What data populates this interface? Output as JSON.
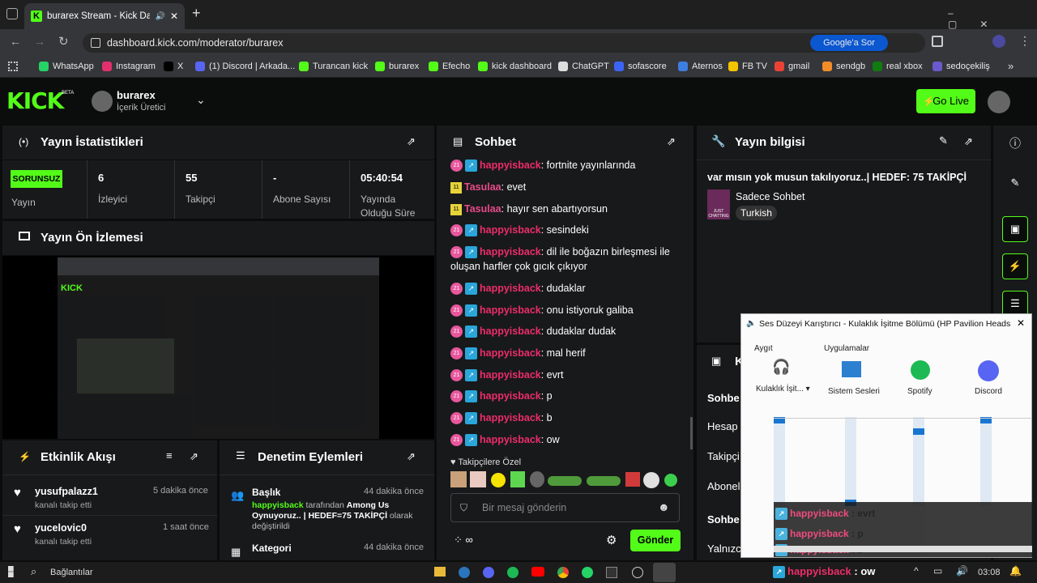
{
  "browser": {
    "tab_title": "burarex Stream - Kick Dashb",
    "url": "dashboard.kick.com/moderator/burarex",
    "google_btn": "Google'a Sor",
    "bookmarks": [
      {
        "label": "WhatsApp",
        "color": "#25d366"
      },
      {
        "label": "Instagram",
        "color": "#e1306c"
      },
      {
        "label": "X",
        "color": "#000000"
      },
      {
        "label": "(1) Discord | Arkada...",
        "color": "#5865f2"
      },
      {
        "label": "Turancan kick",
        "color": "#53fc18"
      },
      {
        "label": "burarex",
        "color": "#53fc18"
      },
      {
        "label": "Efecho",
        "color": "#53fc18"
      },
      {
        "label": "kick dashboard",
        "color": "#53fc18"
      },
      {
        "label": "ChatGPT",
        "color": "#dddddd"
      },
      {
        "label": "sofascore",
        "color": "#3c64f4"
      },
      {
        "label": "Aternos",
        "color": "#3d7ee0"
      },
      {
        "label": "FB TV",
        "color": "#f5c400"
      },
      {
        "label": "gmail",
        "color": "#ea4335"
      },
      {
        "label": "sendgb",
        "color": "#f28c28"
      },
      {
        "label": "real xbox",
        "color": "#107c10"
      },
      {
        "label": "sedoçekiliş",
        "color": "#6a5acd"
      }
    ]
  },
  "header": {
    "logo": "KICK",
    "beta": "BETA",
    "username": "burarex",
    "role": "İçerik Üretici",
    "go_live": "Go Live"
  },
  "stats": {
    "title": "Yayın İstatistikleri",
    "status_badge": "SORUNSUZ",
    "status_label": "Yayın",
    "viewers_value": "6",
    "viewers_label": "İzleyici",
    "followers_value": "55",
    "followers_label": "Takipçi",
    "subs_value": "-",
    "subs_label": "Abone Sayısı",
    "duration_value": "05:40:54",
    "duration_label_1": "Yayında",
    "duration_label_2": "Olduğu Süre"
  },
  "preview": {
    "title": "Yayın Ön İzlemesi"
  },
  "activity": {
    "title": "Etkinlik Akışı",
    "items": [
      {
        "user": "yusufpalazz1",
        "action": "kanalı takip etti",
        "time": "5 dakika önce"
      },
      {
        "user": "yucelovic0",
        "action": "kanalı takip etti",
        "time": "1 saat önce"
      }
    ]
  },
  "moderation": {
    "title": "Denetim Eylemleri",
    "items": [
      {
        "title": "Başlık",
        "time": "44 dakika önce",
        "user": "happyisback",
        "text1": " tarafından ",
        "bold": "Among Us Oynuyoruz.. | HEDEF=75 TAKİPÇİ",
        "text2": " olarak değiştirildi"
      },
      {
        "title": "Kategori",
        "time": "44 dakika önce"
      }
    ]
  },
  "chat": {
    "title": "Sohbet",
    "messages": [
      {
        "badge": "21",
        "user": "happyisback",
        "text": ": fortnite yayınlarında",
        "arrow": true
      },
      {
        "badge": "11",
        "user": "Tasulaa",
        "text": ": evet",
        "arrow": false
      },
      {
        "badge": "11",
        "user": "Tasulaa",
        "text": ": hayır sen abartıyorsun",
        "arrow": false
      },
      {
        "badge": "21",
        "user": "happyisback",
        "text": ": sesindeki",
        "arrow": true
      },
      {
        "badge": "21",
        "user": "happyisback",
        "text": ": dil ile boğazın birleşmesi ile",
        "text2": "oluşan harfler çok gıcık çıkıyor",
        "arrow": true
      },
      {
        "badge": "21",
        "user": "happyisback",
        "text": ": dudaklar",
        "arrow": true
      },
      {
        "badge": "21",
        "user": "happyisback",
        "text": ": onu istiyoruk galiba",
        "arrow": true
      },
      {
        "badge": "21",
        "user": "happyisback",
        "text": ": dudaklar dudak",
        "arrow": true
      },
      {
        "badge": "21",
        "user": "happyisback",
        "text": ": mal herif",
        "arrow": true
      },
      {
        "badge": "21",
        "user": "happyisback",
        "text": ": evrt",
        "arrow": true
      },
      {
        "badge": "21",
        "user": "happyisback",
        "text": ": p",
        "arrow": true
      },
      {
        "badge": "21",
        "user": "happyisback",
        "text": ": b",
        "arrow": true
      },
      {
        "badge": "21",
        "user": "happyisback",
        "text": ": ow",
        "arrow": true
      }
    ],
    "followers_only": "Takipçilere Özel",
    "input_placeholder": "Bir mesaj gönderin",
    "send": "Gönder"
  },
  "info": {
    "title": "Yayın bilgisi",
    "stream_title": "var mısın yok musun takılıyoruz..| HEDEF: 75 TAKİPÇİ",
    "category": "Sadece Sohbet",
    "tag": "Turkish",
    "thumb_text": "JUST CHATTING",
    "second_title_initial": "K",
    "rows": [
      "Sohbe",
      "Hesap y",
      "Takipçi",
      "Abonel",
      "Sohbe",
      "Yalnızca"
    ]
  },
  "mixer": {
    "title": "Ses Düzeyi Karıştırıcı - Kulaklık İşitme Bölümü (HP Pavilion Headset 6...",
    "device_label": "Aygıt",
    "apps_label": "Uygulamalar",
    "device": "Kulaklık İşit...",
    "apps": [
      "Sistem Sesleri",
      "Spotify",
      "Discord"
    ],
    "levels": [
      1.0,
      0.0,
      0.86,
      1.0
    ],
    "overlay": [
      {
        "user": "happyisback",
        "text": " : evrt"
      },
      {
        "user": "happyisback",
        "text": " : p"
      },
      {
        "user": "happyisback",
        "text": " : b"
      }
    ]
  },
  "taskbar": {
    "search": "Bağlantılar",
    "overlay_user": "happyisback",
    "overlay_text": " : ow",
    "time": "03:08",
    "bottom_left": "Yalnızca"
  }
}
